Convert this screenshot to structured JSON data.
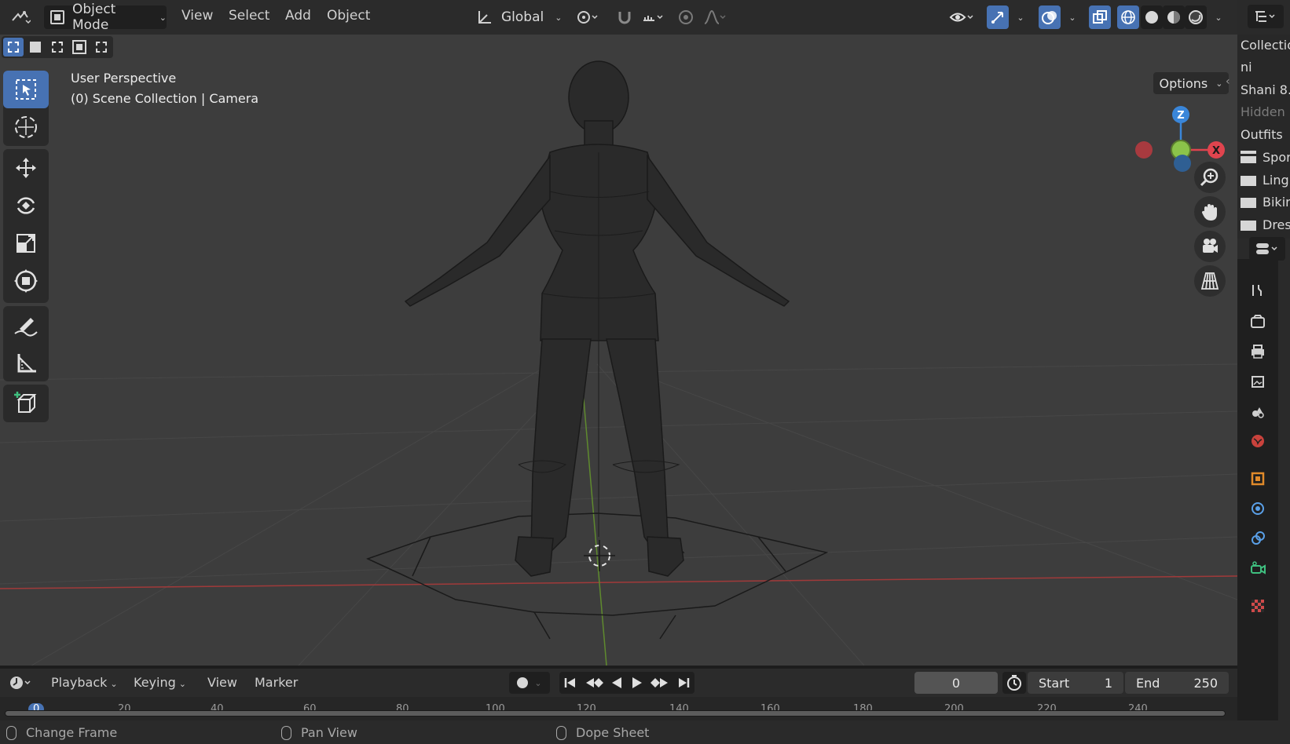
{
  "header": {
    "editor_type_icon": "editor-3d-icon",
    "mode": "Object Mode",
    "menus": [
      "View",
      "Select",
      "Add",
      "Object"
    ],
    "transform_orientation": "Global",
    "options_label": "Options"
  },
  "viewport": {
    "perspective_label": "User Perspective",
    "collection_label": "(0) Scene Collection | Camera",
    "gizmo": {
      "z": "Z",
      "x": "X"
    }
  },
  "outliner": {
    "rows": [
      "Collectio",
      "ni",
      "Shani 8.",
      "Hidden",
      "Outfits",
      "Spor",
      "Ling",
      "Bikir",
      "Dres"
    ]
  },
  "timeline": {
    "menus": [
      "Playback",
      "Keying",
      "View",
      "Marker"
    ],
    "current_frame": "0",
    "start_label": "Start",
    "start_value": "1",
    "end_label": "End",
    "end_value": "250",
    "ruler_ticks": [
      "0",
      "20",
      "40",
      "60",
      "80",
      "100",
      "120",
      "140",
      "160",
      "180",
      "200",
      "220",
      "240"
    ]
  },
  "status": {
    "items": [
      "Change Frame",
      "Pan View",
      "Dope Sheet"
    ]
  },
  "colors": {
    "accent": "#4772b3",
    "axis_x": "#e0444e",
    "axis_y": "#8bc34a",
    "axis_z": "#3a86d9"
  }
}
